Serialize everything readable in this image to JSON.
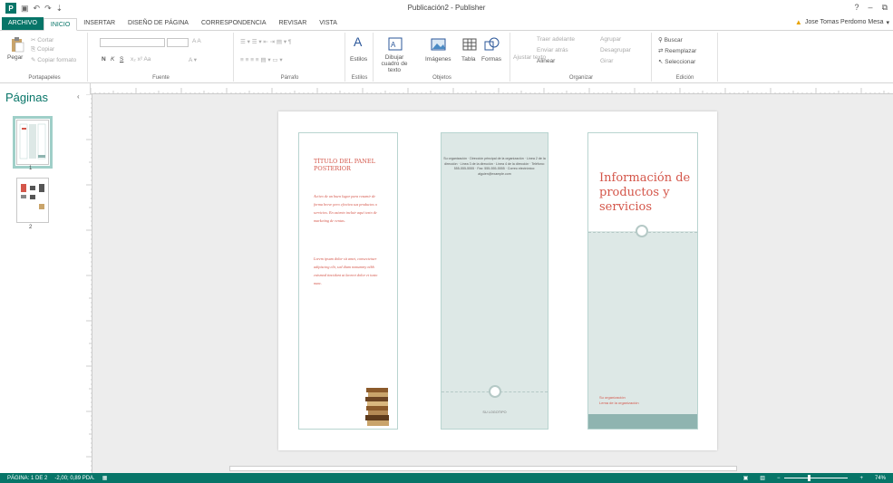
{
  "window": {
    "title": "Publicación2 - Publisher"
  },
  "tabs": [
    {
      "label": "ARCHIVO"
    },
    {
      "label": "INICIO"
    },
    {
      "label": "INSERTAR"
    },
    {
      "label": "DISEÑO DE PÁGINA"
    },
    {
      "label": "CORRESPONDENCIA"
    },
    {
      "label": "REVISAR"
    },
    {
      "label": "VISTA"
    }
  ],
  "user": {
    "name": "Jose Tomas Perdomo Mesa"
  },
  "ribbon": {
    "portapapeles": {
      "paste": "Pegar",
      "cut": "Cortar",
      "copy": "Copiar",
      "format": "Copiar formato",
      "label": "Portapapeles"
    },
    "fuente": {
      "label": "Fuente",
      "bold": "N",
      "italic": "K",
      "underline": "S",
      "font_controls": "x₂ x² Aa",
      "size_grow": "A A"
    },
    "parrafo": {
      "label": "Párrafo"
    },
    "estilos": {
      "btn": "Estilos",
      "label": "Estilos"
    },
    "objetos": {
      "draw": "Dibujar cuadro de texto",
      "images": "Imágenes",
      "table": "Tabla",
      "shapes": "Formas",
      "label": "Objetos"
    },
    "organizar": {
      "wrap": "Ajustar texto",
      "front": "Traer adelante",
      "back": "Enviar atrás",
      "align": "Alinear",
      "group": "Agrupar",
      "ungroup": "Desagrupar",
      "rotate": "Girar",
      "label": "Organizar"
    },
    "edicion": {
      "find": "Buscar",
      "replace": "Reemplazar",
      "select": "Seleccionar",
      "label": "Edición"
    }
  },
  "pages_pane": {
    "title": "Páginas",
    "pages": [
      "1",
      "2"
    ]
  },
  "document": {
    "panel1": {
      "title": "TÍTULO DEL PANEL POSTERIOR",
      "body1": "Activo de un buen lugar para resumir de forma breve pero efectiva sus productos o servicios. En asiento incluir aquí texto de marketing de ventas.",
      "body2": "Lorem ipsum dolor sit amet, consectetuer adipiscing elit, sed diam nonummy nibh euismod tincidunt ut laoreet dolor et iusto nunc."
    },
    "panel2": {
      "contact": "Su organización · Dirección principal de la organización · Línea 2 de la dirección · Línea 3 de la dirección · Línea 4 de la dirección · Teléfono: 555-555-5555 · Fax: 555-555-5555 · Correo electrónico: alguien@example.com",
      "logo": "SU LOGOTIPO"
    },
    "panel3": {
      "heading": "Información de productos y servicios",
      "footer1": "Su organización",
      "footer2": "Lema de la organización"
    }
  },
  "status": {
    "page": "PÁGINA: 1 DE 2",
    "position": "-2,00; 0,89 PDA.",
    "zoom": "74%"
  },
  "colors": {
    "accent": "#077568",
    "red_text": "#d4564a",
    "panel_teal": "#dde8e6",
    "bar_teal": "#8fb4b0"
  }
}
